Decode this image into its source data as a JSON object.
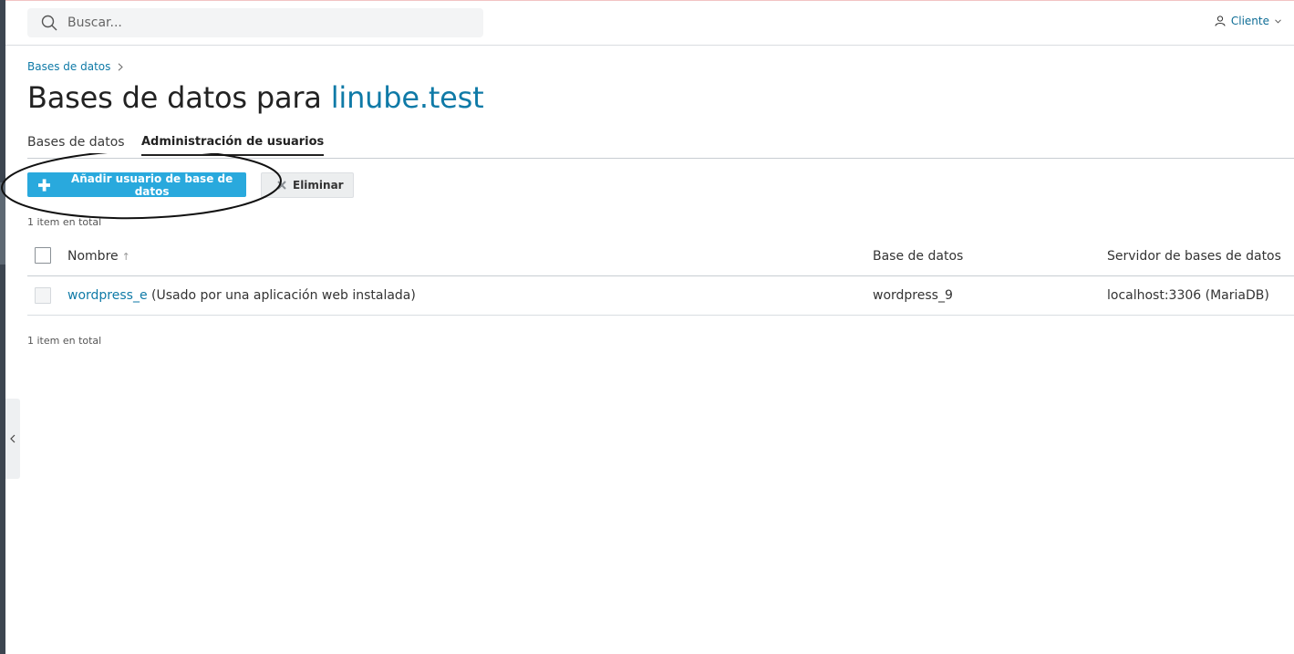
{
  "header": {
    "search_placeholder": "Buscar...",
    "client_label": "Cliente"
  },
  "breadcrumb": {
    "item": "Bases de datos"
  },
  "page": {
    "title_prefix": "Bases de datos para ",
    "title_domain": "linube.test"
  },
  "tabs": [
    {
      "label": "Bases de datos",
      "active": false
    },
    {
      "label": "Administración de usuarios",
      "active": true
    }
  ],
  "toolbar": {
    "add_label": "Añadir usuario de base de datos",
    "delete_label": "Eliminar"
  },
  "count_text": "1 item en total",
  "table": {
    "columns": {
      "name": "Nombre",
      "database": "Base de datos",
      "server": "Servidor de bases de datos"
    },
    "rows": [
      {
        "name": "wordpress_e",
        "note": " (Usado por una aplicación web instalada)",
        "database": "wordpress_9",
        "server": "localhost:3306 (MariaDB)"
      }
    ]
  },
  "colors": {
    "accent": "#29a9dd",
    "link": "#0f7aa7",
    "rail": "#3c4550"
  },
  "icons": {
    "search": "search-icon",
    "user": "user-icon",
    "chevron": "chevron-down-icon",
    "plus": "plus-icon",
    "delete": "x-icon",
    "collapse": "chevron-left-icon"
  }
}
